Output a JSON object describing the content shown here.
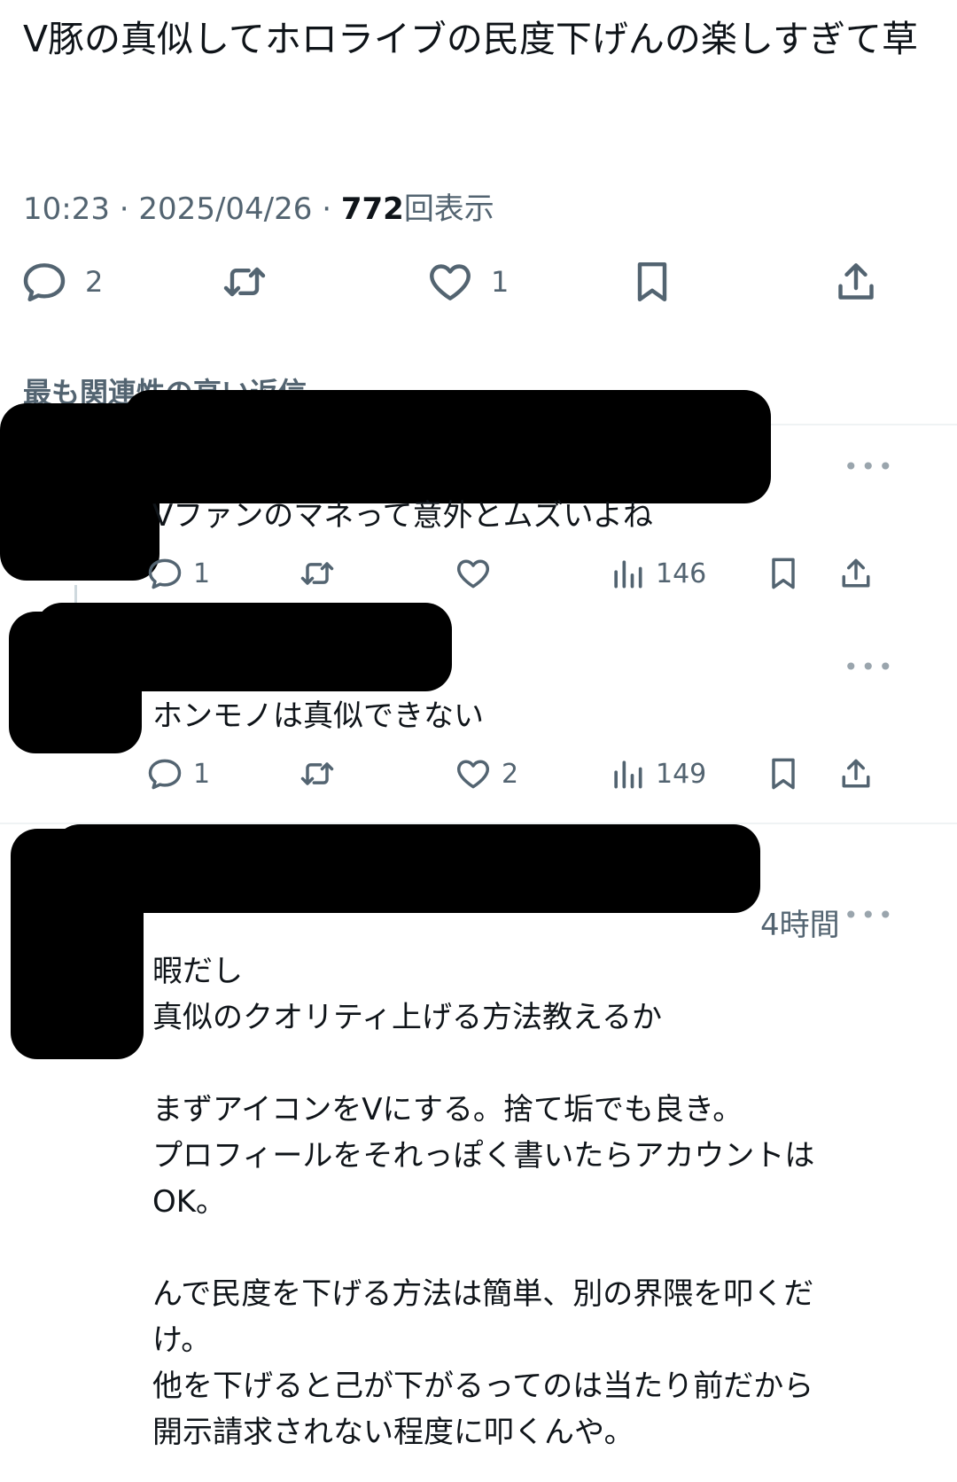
{
  "tweet": {
    "text": "V豚の真似してホロライブの民度下げんの楽しすぎて草",
    "time": "10:23",
    "date": "2025/04/26",
    "views": "772",
    "views_label": "回表示",
    "actions": {
      "replies": "2",
      "retweets": "",
      "likes": "1"
    }
  },
  "replies_header": {
    "label": "最も関連性の高い返信",
    "chevron": "chevron-down-icon"
  },
  "replies": [
    {
      "text": "Vファンのマネって意外とムズいよね",
      "replies": "1",
      "retweets": "",
      "likes": "",
      "views": "146"
    },
    {
      "text": "ホンモノは真似できない",
      "replies": "1",
      "retweets": "",
      "likes": "2",
      "views": "149"
    },
    {
      "time": "4時間",
      "lines": [
        "暇だし",
        "真似のクオリティ上げる方法教えるか",
        "",
        "まずアイコンをVにする。捨て垢でも良き。",
        "プロフィールをそれっぽく書いたらアカウントは",
        "OK。",
        "",
        "んで民度を下げる方法は簡単、別の界隈を叩くだ",
        "け。",
        "他を下げると己が下がるってのは当たり前だから",
        "開示請求されない程度に叩くんや。"
      ]
    }
  ],
  "icons": [
    "reply-icon",
    "retweet-icon",
    "like-icon",
    "bookmark-icon",
    "share-icon",
    "views-icon",
    "more-icon"
  ],
  "colors": {
    "text": "#0f1419",
    "secondary": "#536471",
    "divider": "#eff3f4"
  }
}
